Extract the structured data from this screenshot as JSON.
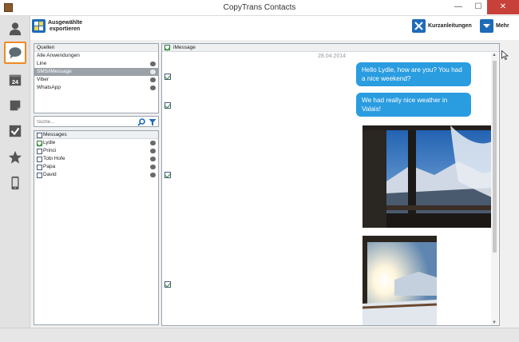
{
  "window": {
    "title": "CopyTrans Contacts",
    "minimize_glyph": "—",
    "maximize_glyph": "☐",
    "close_glyph": "✕"
  },
  "sidebar": {
    "items": [
      {
        "icon": "contacts-icon"
      },
      {
        "icon": "messages-icon",
        "active": true
      },
      {
        "icon": "calendar-icon",
        "badge": "24"
      },
      {
        "icon": "notes-icon"
      },
      {
        "icon": "tasks-icon"
      },
      {
        "icon": "bookmarks-icon"
      },
      {
        "icon": "device-icon"
      }
    ]
  },
  "toolbar": {
    "export_label_line1": "Ausgewählte",
    "export_label_line2": "exportieren",
    "guides_label": "Kurzanleitungen",
    "more_label": "Mehr"
  },
  "sources": {
    "header": "Quellen",
    "items": [
      {
        "label": "Alle Anwendungen"
      },
      {
        "label": "Line"
      },
      {
        "label": "SMS/iMessage",
        "selected": true
      },
      {
        "label": "Viber"
      },
      {
        "label": "WhatsApp"
      }
    ]
  },
  "search": {
    "placeholder": "Suche..."
  },
  "chats": {
    "header": "Messages",
    "items": [
      {
        "label": "Lydie",
        "checked": true
      },
      {
        "label": "Princi",
        "checked": false
      },
      {
        "label": "Tobi Hofe",
        "checked": false
      },
      {
        "label": "Papa",
        "checked": false
      },
      {
        "label": "David",
        "checked": false
      }
    ]
  },
  "conversation": {
    "header": "iMessage",
    "date": "28.04.2014",
    "messages": [
      {
        "text": "Hello Lydie, how are you? You had a nice weekend?"
      },
      {
        "text": "We had really nice weather in Valais!"
      }
    ]
  },
  "colors": {
    "accent": "#2a9ce0",
    "highlight": "#f08a24",
    "selected_row": "#9aa1a8"
  }
}
